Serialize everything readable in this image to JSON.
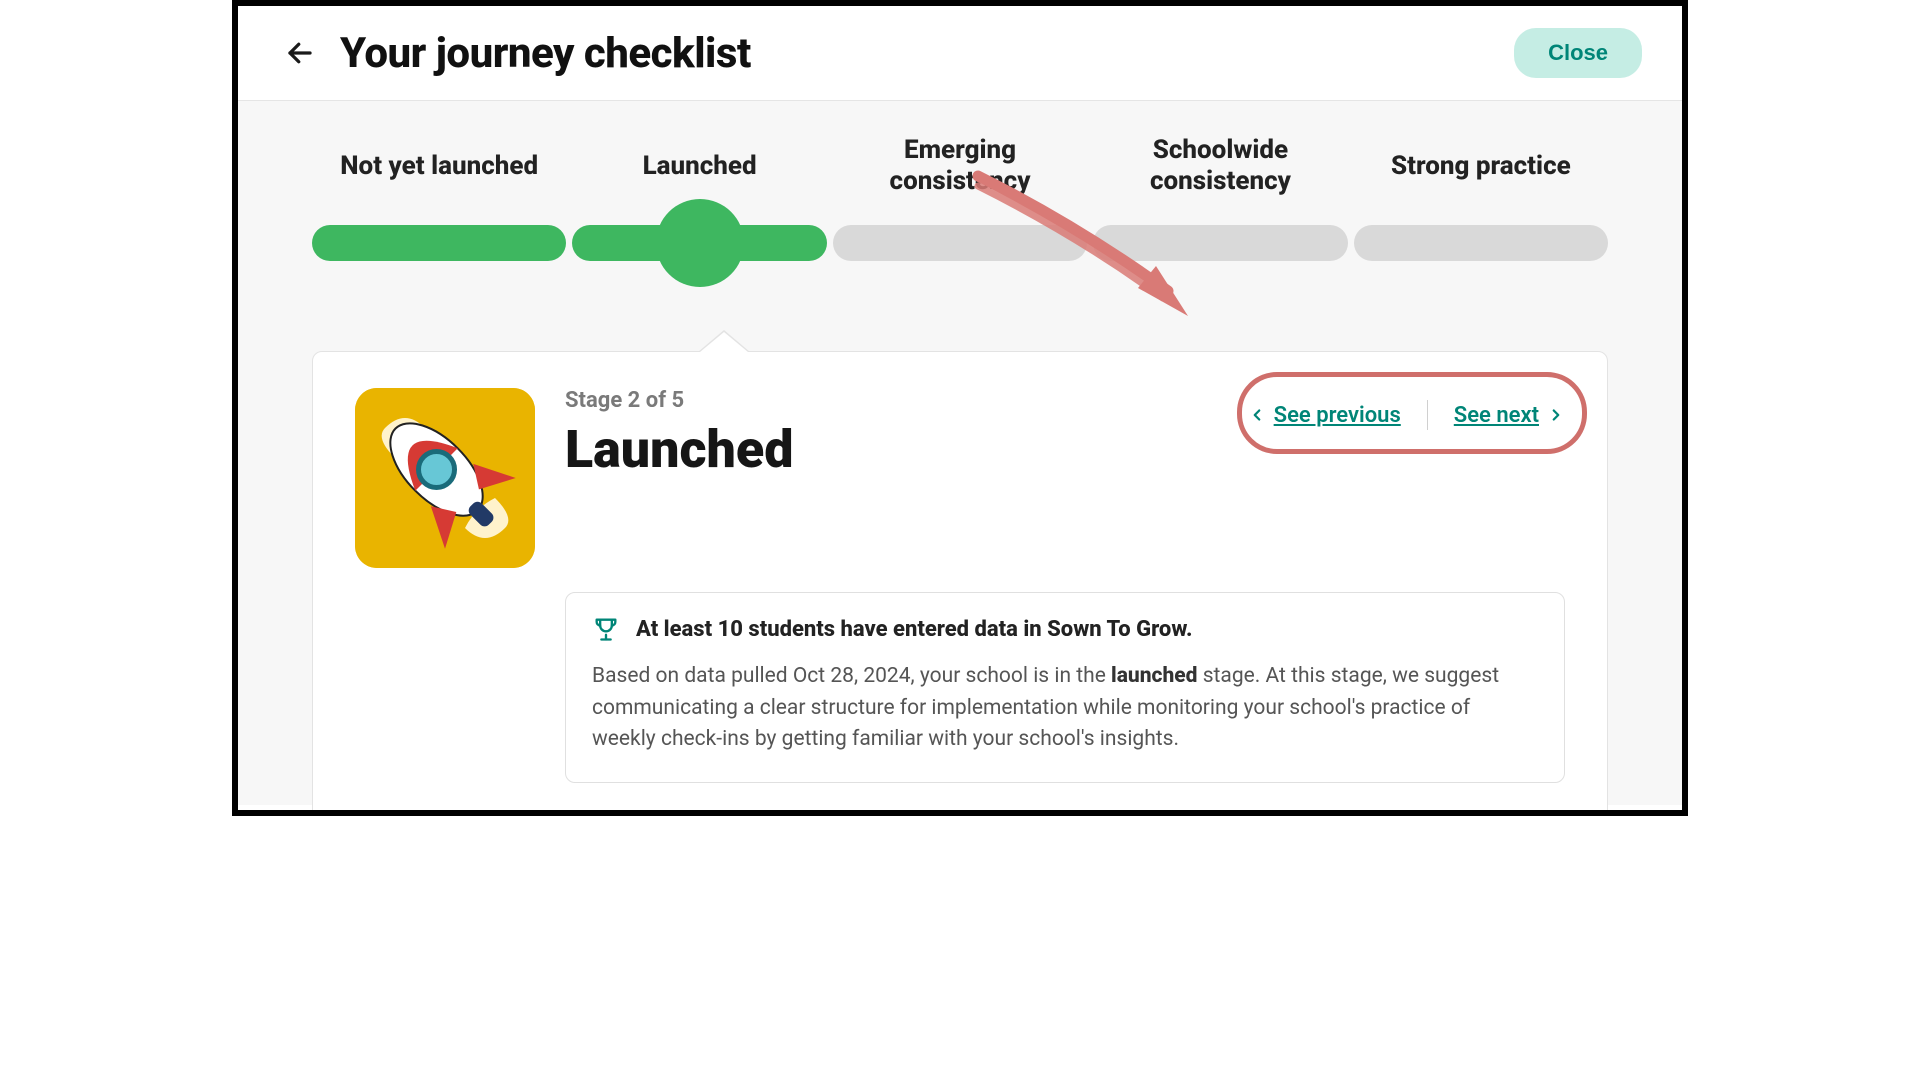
{
  "header": {
    "title": "Your journey checklist",
    "close_label": "Close"
  },
  "stages": {
    "labels": [
      "Not yet launched",
      "Launched",
      "Emerging consistency",
      "Schoolwide consistency",
      "Strong practice"
    ],
    "current_index": 1,
    "progress_colors": {
      "done": "#3eb760",
      "pending": "#d9d9d9"
    }
  },
  "card": {
    "stage_counter": "Stage 2 of 5",
    "stage_title": "Launched",
    "nav": {
      "prev_label": "See previous",
      "next_label": "See next"
    },
    "info": {
      "headline": "At least 10 students have entered data in Sown To Grow.",
      "body_pre": "Based on data pulled Oct 28, 2024, your school is in the ",
      "body_bold": "launched",
      "body_post": " stage. At this stage, we suggest communicating a clear structure for implementation while monitoring your school's practice of weekly check-ins by getting familiar with your school's insights."
    }
  },
  "colors": {
    "accent": "#008577",
    "accent_bg": "#c5ede4",
    "annotation": "#cf6f6b"
  }
}
